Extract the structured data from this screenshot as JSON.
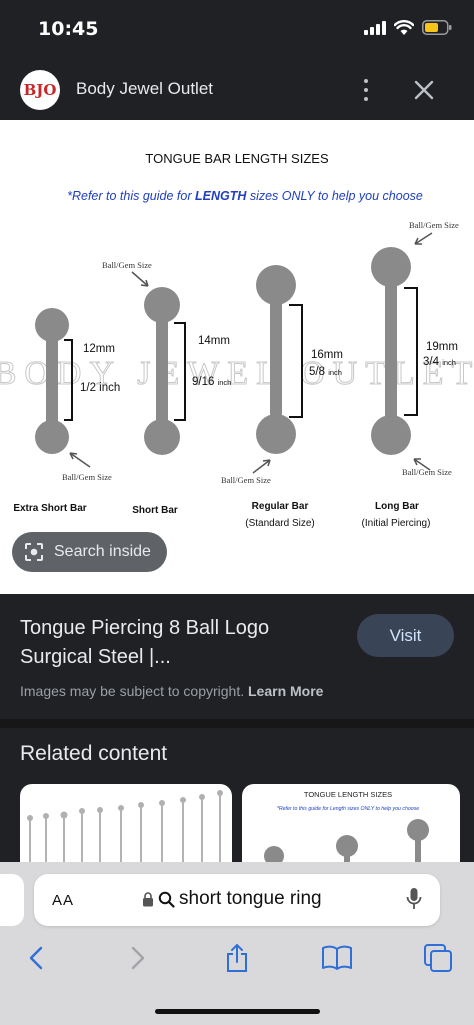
{
  "status_bar": {
    "time": "10:45"
  },
  "header": {
    "site_name": "Body Jewel Outlet",
    "logo_text": "BJO"
  },
  "image": {
    "title": "TONGUE BAR LENGTH SIZES",
    "subtitle_pre": "*Refer to this guide for ",
    "subtitle_bold": "LENGTH",
    "subtitle_post": " sizes ONLY to help you choose",
    "watermark": "BODY JEWEL OUTLET",
    "ball_gem_label": "Ball/Gem Size",
    "bars": [
      {
        "name": "Extra Short Bar",
        "sub": "",
        "mm": "12mm",
        "inch": "1/2 inch"
      },
      {
        "name": "Short Bar",
        "sub": "",
        "mm": "14mm",
        "inch": "9/16",
        "inch_unit": "inch"
      },
      {
        "name": "Regular Bar",
        "sub": "(Standard Size)",
        "mm": "16mm",
        "inch": "5/8",
        "inch_unit": "inch"
      },
      {
        "name": "Long Bar",
        "sub": "(Initial Piercing)",
        "mm": "19mm",
        "inch": "3/4",
        "inch_unit": "inch"
      }
    ]
  },
  "lens_button": {
    "label": "Search inside"
  },
  "result": {
    "title": "Tongue Piercing 8 Ball Logo Surgical Steel |...",
    "visit_label": "Visit",
    "copyright": "Images may be subject to copyright.",
    "learn_more": "Learn More"
  },
  "related": {
    "title": "Related content",
    "thumb2_title": "TONGUE LENGTH SIZES",
    "thumb2_sub": "*Refer to this guide for Length sizes ONLY to help you choose"
  },
  "browser": {
    "aa_label": "AA",
    "url_text": "short tongue ring"
  }
}
